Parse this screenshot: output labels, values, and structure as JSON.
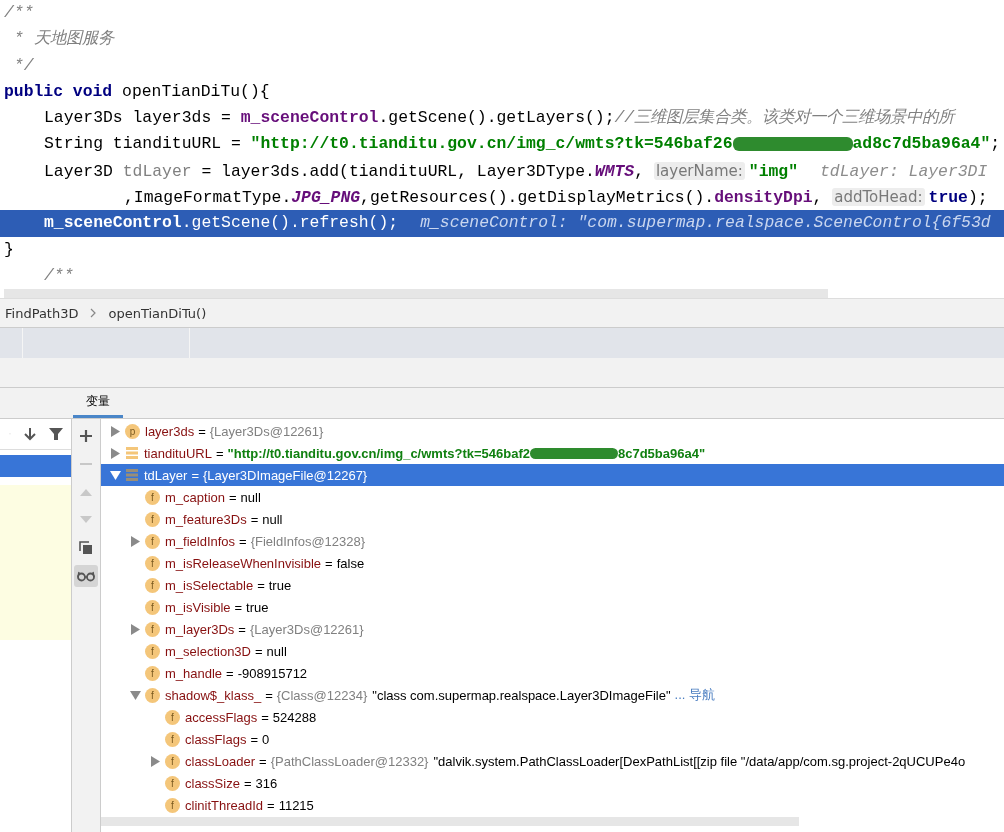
{
  "editor": {
    "lines": [
      {
        "kind": "top",
        "selected": false,
        "tokens": [
          {
            "kind": "comment",
            "text": "/**"
          }
        ]
      },
      {
        "kind": "top",
        "selected": false,
        "tokens": [
          {
            "kind": "comment",
            "text": " * 天地图服务"
          }
        ]
      },
      {
        "kind": "top",
        "selected": false,
        "tokens": [
          {
            "kind": "comment",
            "text": " */"
          }
        ]
      },
      {
        "kind": "top",
        "selected": false,
        "tokens": [
          {
            "kind": "keyword",
            "text": "public void "
          },
          {
            "kind": "plain",
            "text": "openTianDiTu(){"
          }
        ]
      },
      {
        "kind": "body",
        "selected": false,
        "tokens": [
          {
            "kind": "plain",
            "text": "Layer3Ds layer3ds = "
          },
          {
            "kind": "field",
            "text": "m_sceneControl"
          },
          {
            "kind": "plain",
            "text": ".getScene().getLayers();"
          },
          {
            "kind": "comment",
            "text": "//三维图层集合类。该类对一个三维场景中的所"
          }
        ]
      },
      {
        "kind": "body",
        "selected": false,
        "tokens": [
          {
            "kind": "plain",
            "text": "String tiandituURL = "
          },
          {
            "kind": "string",
            "text": "\"http://t0.tianditu.gov.cn/img_c/wmts?tk=546baf26"
          },
          {
            "kind": "redaction"
          },
          {
            "kind": "string",
            "text": "ad8c7d5ba96a4\""
          },
          {
            "kind": "plain",
            "text": ";"
          }
        ]
      },
      {
        "kind": "body",
        "selected": false,
        "tokens": [
          {
            "kind": "plain",
            "text": "Layer3D "
          },
          {
            "kind": "unused",
            "text": "tdLayer"
          },
          {
            "kind": "plain",
            "text": " = layer3ds.add(tiandituURL, Layer3DType."
          },
          {
            "kind": "const",
            "text": "WMTS"
          },
          {
            "kind": "plain",
            "text": ", "
          },
          {
            "kind": "hint",
            "text": "layerName:"
          },
          {
            "kind": "string",
            "text": "\"img\""
          },
          {
            "kind": "inline",
            "text": "tdLayer: Layer3DI"
          }
        ]
      },
      {
        "kind": "continuation",
        "selected": false,
        "tokens": [
          {
            "kind": "plain",
            "text": ",ImageFormatType."
          },
          {
            "kind": "const",
            "text": "JPG_PNG"
          },
          {
            "kind": "plain",
            "text": ",getResources().getDisplayMetrics()."
          },
          {
            "kind": "field",
            "text": "densityDpi"
          },
          {
            "kind": "plain",
            "text": ", "
          },
          {
            "kind": "hint",
            "text": "addToHead:"
          },
          {
            "kind": "keyword",
            "text": "true"
          },
          {
            "kind": "plain",
            "text": ");"
          }
        ]
      },
      {
        "kind": "body",
        "selected": true,
        "tokens": [
          {
            "kind": "field",
            "text": "m_sceneControl"
          },
          {
            "kind": "plain",
            "text": ".getScene().refresh();"
          },
          {
            "kind": "inline",
            "text": "m_sceneControl: \"com.supermap.realspace.SceneControl{6f53d"
          }
        ]
      },
      {
        "kind": "top",
        "selected": false,
        "tokens": [
          {
            "kind": "plain",
            "text": "}"
          }
        ]
      },
      {
        "kind": "body",
        "selected": false,
        "tokens": [
          {
            "kind": "comment",
            "text": "/**"
          }
        ]
      }
    ]
  },
  "breadcrumb": [
    "FindPath3D",
    "openTianDiTu()"
  ],
  "tabs": [
    {
      "label": "变量",
      "selected": true
    }
  ],
  "frames_toolbar": [
    {
      "kind": "up",
      "disabled": true
    },
    {
      "kind": "down",
      "disabled": false
    },
    {
      "kind": "filter",
      "disabled": false
    }
  ],
  "side_toolbar": [
    {
      "kind": "plus",
      "disabled": false,
      "selected": false
    },
    {
      "kind": "minus",
      "disabled": true,
      "selected": false
    },
    {
      "kind": "up",
      "disabled": true,
      "selected": false
    },
    {
      "kind": "down",
      "disabled": true,
      "selected": false
    },
    {
      "kind": "copy",
      "disabled": false,
      "selected": false
    },
    {
      "kind": "glasses",
      "disabled": false,
      "selected": true
    }
  ],
  "variables": [
    {
      "kind": "param",
      "badge": "p",
      "name": "layer3ds",
      "eq": "=",
      "expanded": false,
      "selected": false,
      "value": [
        {
          "kind": "ref",
          "text": "{Layer3Ds@12261}"
        }
      ]
    },
    {
      "kind": "local",
      "name": "tiandituURL",
      "eq": "=",
      "expanded": false,
      "selected": false,
      "value": [
        {
          "kind": "string",
          "text": "\"http://t0.tianditu.gov.cn/img_c/wmts?tk=546baf2"
        },
        {
          "kind": "redaction"
        },
        {
          "kind": "string",
          "text": "8c7d5ba96a4\""
        }
      ]
    },
    {
      "kind": "local",
      "name": "tdLayer",
      "eq": "=",
      "expanded": true,
      "selected": true,
      "value": [
        {
          "kind": "ref",
          "text": "{Layer3DImageFile@12267}"
        }
      ],
      "children": [
        {
          "kind": "field",
          "badge": "f",
          "name": "m_caption",
          "eq": "=",
          "selected": false,
          "value": [
            {
              "kind": "plain",
              "text": "null"
            }
          ]
        },
        {
          "kind": "field",
          "badge": "f",
          "name": "m_feature3Ds",
          "eq": "=",
          "selected": false,
          "value": [
            {
              "kind": "plain",
              "text": "null"
            }
          ]
        },
        {
          "kind": "field",
          "badge": "f",
          "name": "m_fieldInfos",
          "eq": "=",
          "expanded": false,
          "selected": false,
          "value": [
            {
              "kind": "ref",
              "text": "{FieldInfos@12328}"
            }
          ]
        },
        {
          "kind": "field",
          "badge": "f",
          "name": "m_isReleaseWhenInvisible",
          "eq": "=",
          "selected": false,
          "value": [
            {
              "kind": "plain",
              "text": "false"
            }
          ]
        },
        {
          "kind": "field",
          "badge": "f",
          "name": "m_isSelectable",
          "eq": "=",
          "selected": false,
          "value": [
            {
              "kind": "plain",
              "text": "true"
            }
          ]
        },
        {
          "kind": "field",
          "badge": "f",
          "name": "m_isVisible",
          "eq": "=",
          "selected": false,
          "value": [
            {
              "kind": "plain",
              "text": "true"
            }
          ]
        },
        {
          "kind": "field",
          "badge": "f",
          "name": "m_layer3Ds",
          "eq": "=",
          "expanded": false,
          "selected": false,
          "value": [
            {
              "kind": "ref",
              "text": "{Layer3Ds@12261}"
            }
          ]
        },
        {
          "kind": "field",
          "badge": "f",
          "name": "m_selection3D",
          "eq": "=",
          "selected": false,
          "value": [
            {
              "kind": "plain",
              "text": "null"
            }
          ]
        },
        {
          "kind": "field",
          "badge": "f",
          "name": "m_handle",
          "eq": "=",
          "selected": false,
          "value": [
            {
              "kind": "plain",
              "text": "-908915712"
            }
          ]
        },
        {
          "kind": "field",
          "badge": "f",
          "name": "shadow$_klass_",
          "eq": "=",
          "expanded": true,
          "selected": false,
          "value": [
            {
              "kind": "ref",
              "text": "{Class@12234}"
            },
            {
              "kind": "plain",
              "text": "\"class com.supermap.realspace.Layer3DImageFile\""
            },
            {
              "kind": "link",
              "text": "... 导航"
            }
          ],
          "children": [
            {
              "kind": "field",
              "badge": "f",
              "name": "accessFlags",
              "eq": "=",
              "selected": false,
              "value": [
                {
                  "kind": "plain",
                  "text": "524288"
                }
              ]
            },
            {
              "kind": "field",
              "badge": "f",
              "name": "classFlags",
              "eq": "=",
              "selected": false,
              "value": [
                {
                  "kind": "plain",
                  "text": "0"
                }
              ]
            },
            {
              "kind": "field",
              "badge": "f",
              "name": "classLoader",
              "eq": "=",
              "expanded": false,
              "selected": false,
              "value": [
                {
                  "kind": "ref",
                  "text": "{PathClassLoader@12332}"
                },
                {
                  "kind": "plain",
                  "text": "\"dalvik.system.PathClassLoader[DexPathList[[zip file \"/data/app/com.sg.project-2qUCUPe4o"
                }
              ]
            },
            {
              "kind": "field",
              "badge": "f",
              "name": "classSize",
              "eq": "=",
              "selected": false,
              "value": [
                {
                  "kind": "plain",
                  "text": "316"
                }
              ]
            },
            {
              "kind": "field",
              "badge": "f",
              "name": "clinitThreadId",
              "eq": "=",
              "selected": false,
              "value": [
                {
                  "kind": "plain",
                  "text": "11215"
                }
              ]
            }
          ]
        }
      ]
    }
  ]
}
